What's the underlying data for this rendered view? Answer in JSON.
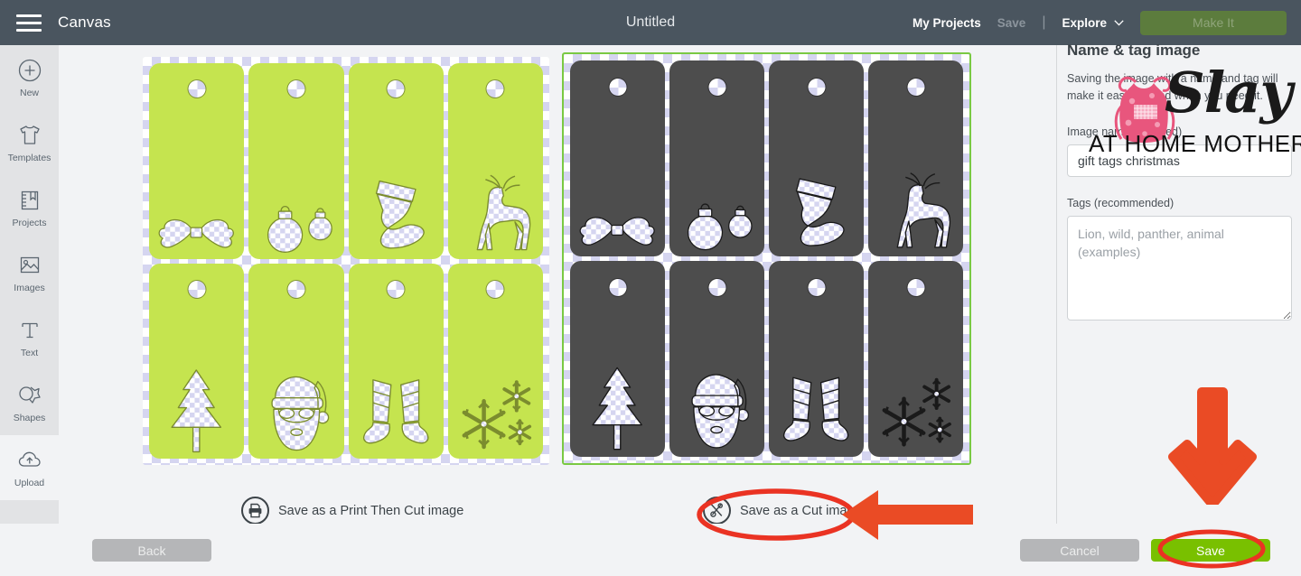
{
  "header": {
    "menu_icon": "hamburger-icon",
    "canvas_label": "Canvas",
    "title": "Untitled",
    "my_projects": "My Projects",
    "save": "Save",
    "separator": "|",
    "explore": "Explore",
    "chevron_icon": "chevron-down-icon",
    "make_it": "Make It",
    "bg_color": "#4a555f",
    "make_it_color": "#5c7c3d"
  },
  "sidebar": {
    "items": [
      {
        "label": "New",
        "icon": "plus-circle-icon",
        "active": false
      },
      {
        "label": "Templates",
        "icon": "tshirt-icon",
        "active": false
      },
      {
        "label": "Projects",
        "icon": "book-icon",
        "active": false
      },
      {
        "label": "Images",
        "icon": "image-icon",
        "active": false
      },
      {
        "label": "Text",
        "icon": "text-t-icon",
        "active": false
      },
      {
        "label": "Shapes",
        "icon": "shapes-icon",
        "active": false
      },
      {
        "label": "Upload",
        "icon": "upload-cloud-icon",
        "active": true
      }
    ]
  },
  "preview": {
    "left_panel": {
      "name": "print-then-cut-preview",
      "selected": false,
      "fill_color": "#c5e44f",
      "tags": [
        {
          "design": "bow"
        },
        {
          "design": "ornaments"
        },
        {
          "design": "stocking"
        },
        {
          "design": "reindeer"
        },
        {
          "design": "tree"
        },
        {
          "design": "santa"
        },
        {
          "design": "elf-boots"
        },
        {
          "design": "snowflakes"
        }
      ]
    },
    "right_panel": {
      "name": "cut-image-preview",
      "selected": true,
      "selection_color": "#7ac943",
      "fill_color": "#4d4d4d",
      "tags": [
        {
          "design": "bow"
        },
        {
          "design": "ornaments"
        },
        {
          "design": "stocking"
        },
        {
          "design": "reindeer"
        },
        {
          "design": "tree"
        },
        {
          "design": "santa"
        },
        {
          "design": "elf-boots"
        },
        {
          "design": "snowflakes"
        }
      ]
    }
  },
  "save_options": [
    {
      "label": "Save as a Print Then Cut image",
      "icon": "printer-icon"
    },
    {
      "label": "Save as a Cut image",
      "icon": "scissors-icon"
    }
  ],
  "side_panel": {
    "title": "Name & tag image",
    "description": "Saving the image with a name and tag will make it easier to find when you need it.",
    "image_name_label": "Image name (required)",
    "image_name_value": "gift tags christmas",
    "tags_label": "Tags (recommended)",
    "tags_placeholder": "Lion, wild, panther, animal (examples)"
  },
  "footer": {
    "back": "Back",
    "cancel": "Cancel",
    "save": "Save",
    "save_color": "#79c000"
  },
  "watermark": {
    "brand": "Slay",
    "tagline": "AT HOME MOTHER",
    "icon": "apron-icon",
    "color": "#e8567d"
  },
  "annotations": {
    "color": "#ea3323",
    "arrow_color": "#ea4b25",
    "items": [
      {
        "name": "ellipse-around-save-as-cut-image",
        "shape": "ellipse"
      },
      {
        "name": "arrow-pointing-to-save-as-cut-image",
        "shape": "arrow-left"
      },
      {
        "name": "arrow-pointing-to-save-button",
        "shape": "arrow-down"
      },
      {
        "name": "ellipse-around-save-button",
        "shape": "ellipse"
      }
    ]
  }
}
